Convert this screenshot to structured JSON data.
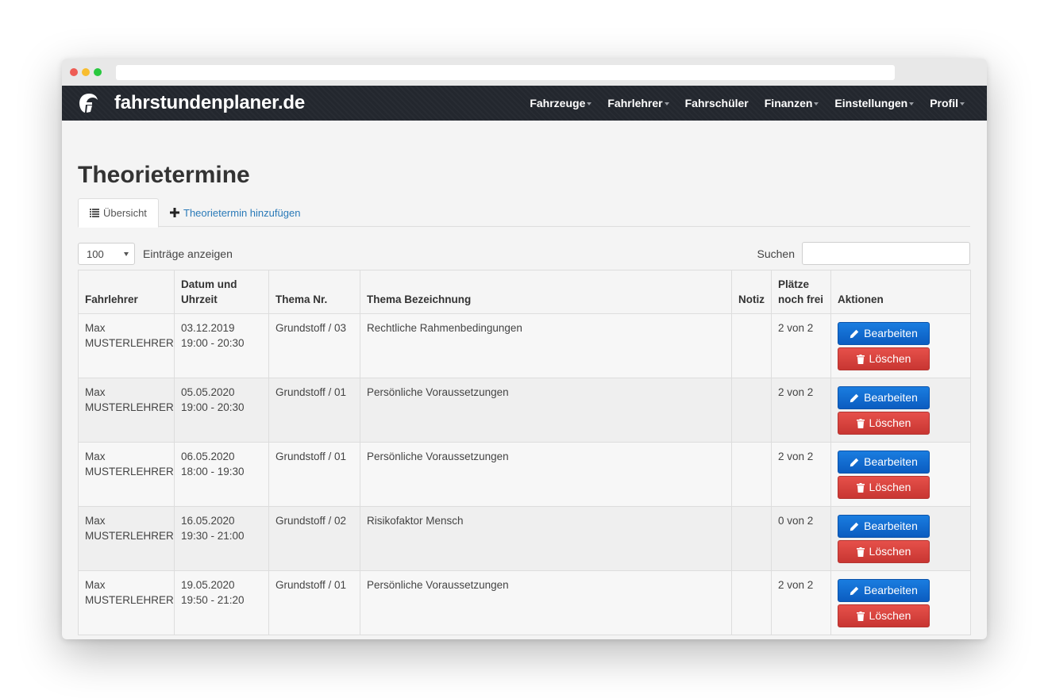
{
  "app": {
    "brand": "fahrstundenplaner.de"
  },
  "nav": {
    "items": [
      {
        "label": "Fahrzeuge",
        "dropdown": true
      },
      {
        "label": "Fahrlehrer",
        "dropdown": true
      },
      {
        "label": "Fahrschüler",
        "dropdown": false
      },
      {
        "label": "Finanzen",
        "dropdown": true
      },
      {
        "label": "Einstellungen",
        "dropdown": true
      },
      {
        "label": "Profil",
        "dropdown": true
      }
    ]
  },
  "page": {
    "title": "Theorietermine"
  },
  "tabs": {
    "overview": "Übersicht",
    "add": "Theorietermin hinzufügen"
  },
  "list_controls": {
    "length_value": "100",
    "length_label": "Einträge anzeigen",
    "search_label": "Suchen",
    "search_value": ""
  },
  "table": {
    "headers": {
      "teacher": "Fahrlehrer",
      "datetime_line1": "Datum und",
      "datetime_line2": "Uhrzeit",
      "topic_no": "Thema Nr.",
      "topic_name": "Thema Bezeichnung",
      "note": "Notiz",
      "seats_line1": "Plätze",
      "seats_line2": "noch frei",
      "actions": "Aktionen"
    },
    "rows": [
      {
        "teacher_first": "Max",
        "teacher_last": "MUSTERLEHRER",
        "date": "03.12.2019",
        "time": "19:00 - 20:30",
        "topic_no": "Grundstoff / 03",
        "topic_name": "Rechtliche Rahmenbedingungen",
        "note": "",
        "seats": "2 von 2"
      },
      {
        "teacher_first": "Max",
        "teacher_last": "MUSTERLEHRER",
        "date": "05.05.2020",
        "time": "19:00 - 20:30",
        "topic_no": "Grundstoff / 01",
        "topic_name": "Persönliche Voraussetzungen",
        "note": "",
        "seats": "2 von 2"
      },
      {
        "teacher_first": "Max",
        "teacher_last": "MUSTERLEHRER",
        "date": "06.05.2020",
        "time": "18:00 - 19:30",
        "topic_no": "Grundstoff / 01",
        "topic_name": "Persönliche Voraussetzungen",
        "note": "",
        "seats": "2 von 2"
      },
      {
        "teacher_first": "Max",
        "teacher_last": "MUSTERLEHRER",
        "date": "16.05.2020",
        "time": "19:30 - 21:00",
        "topic_no": "Grundstoff / 02",
        "topic_name": "Risikofaktor Mensch",
        "note": "",
        "seats": "0 von 2"
      },
      {
        "teacher_first": "Max",
        "teacher_last": "MUSTERLEHRER",
        "date": "19.05.2020",
        "time": "19:50 - 21:20",
        "topic_no": "Grundstoff / 01",
        "topic_name": "Persönliche Voraussetzungen",
        "note": "",
        "seats": "2 von 2"
      }
    ]
  },
  "buttons": {
    "edit": "Bearbeiten",
    "delete": "Löschen"
  },
  "colors": {
    "navbar": "#23272e",
    "link": "#2a7ab8",
    "edit": "#1a6fd6",
    "delete": "#d9443f"
  },
  "icons": {
    "logo": "spartan-helmet-icon",
    "overview_tab": "list-icon",
    "add_tab": "plus-icon",
    "edit": "pencil-icon",
    "delete": "trash-icon"
  }
}
